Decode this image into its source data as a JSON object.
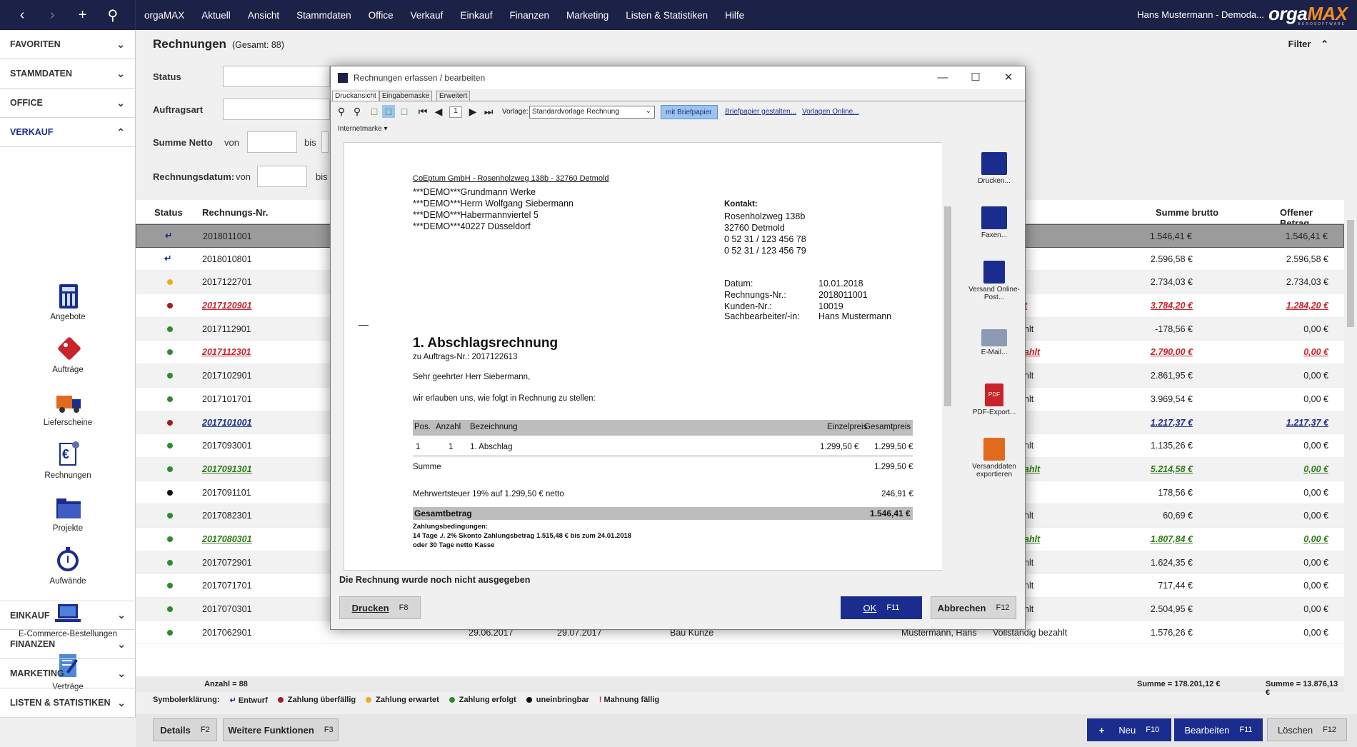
{
  "topbar": {
    "menu": [
      "orgaMAX",
      "Aktuell",
      "Ansicht",
      "Stammdaten",
      "Office",
      "Verkauf",
      "Einkauf",
      "Finanzen",
      "Marketing",
      "Listen & Statistiken",
      "Hilfe"
    ],
    "user": "Hans Mustermann - Demoda...",
    "logo_a": "orga",
    "logo_b": "MAX",
    "logo_sub": "BÜROSOFTWARE"
  },
  "sidebar": {
    "top": [
      "FAVORITEN",
      "STAMMDATEN",
      "OFFICE",
      "VERKAUF"
    ],
    "items": [
      "Angebote",
      "Aufträge",
      "Lieferscheine",
      "Rechnungen",
      "Projekte",
      "Aufwände",
      "E-Commerce-Bestellungen",
      "Verträge"
    ],
    "bottom": [
      "EINKAUF",
      "FINANZEN",
      "MARKETING",
      "LISTEN & STATISTIKEN"
    ]
  },
  "page": {
    "title": "Rechnungen",
    "count": "(Gesamt: 88)",
    "filter": "Filter",
    "status_lbl": "Status",
    "auftragsart_lbl": "Auftragsart",
    "summe_lbl": "Summe Netto",
    "von": "von",
    "bis": "bis",
    "datum_lbl": "Rechnungsdatum:",
    "datum_von": "von"
  },
  "grid": {
    "headers": {
      "status": "Status",
      "nr": "Rechnungs-Nr.",
      "brutto": "Summe brutto",
      "offen": "Offener Betrag"
    },
    "rows": [
      {
        "nr": "2018011001",
        "brutto": "1.546,41 €",
        "offen": "1.546,41 €",
        "mid": ""
      },
      {
        "nr": "2018010801",
        "brutto": "2.596,58 €",
        "offen": "2.596,58 €",
        "mid": ""
      },
      {
        "nr": "2017122701",
        "brutto": "2.734,03 €",
        "offen": "2.734,03 €",
        "mid": ""
      },
      {
        "nr": "2017120901",
        "brutto": "3.784,20 €",
        "offen": "1.284,20 €",
        "mid": "t"
      },
      {
        "nr": "2017112901",
        "brutto": "-178,56 €",
        "offen": "0,00 €",
        "mid": "hlt"
      },
      {
        "nr": "2017112301",
        "brutto": "2.790,00 €",
        "offen": "0,00 €",
        "mid": "ahlt"
      },
      {
        "nr": "2017102901",
        "brutto": "2.861,95 €",
        "offen": "0,00 €",
        "mid": "hlt"
      },
      {
        "nr": "2017101701",
        "brutto": "3.969,54 €",
        "offen": "0,00 €",
        "mid": "hlt"
      },
      {
        "nr": "2017101001",
        "brutto": "1.217,37 €",
        "offen": "1.217,37 €",
        "mid": ""
      },
      {
        "nr": "2017093001",
        "brutto": "1.135,26 €",
        "offen": "0,00 €",
        "mid": "hlt"
      },
      {
        "nr": "2017091301",
        "brutto": "5.214,58 €",
        "offen": "0,00 €",
        "mid": "ahlt"
      },
      {
        "nr": "2017091101",
        "brutto": "178,56 €",
        "offen": "0,00 €",
        "mid": ""
      },
      {
        "nr": "2017082301",
        "brutto": "60,69 €",
        "offen": "0,00 €",
        "mid": "hlt"
      },
      {
        "nr": "2017080301",
        "brutto": "1.807,84 €",
        "offen": "0,00 €",
        "mid": "ahlt"
      },
      {
        "nr": "2017072901",
        "brutto": "1.624,35 €",
        "offen": "0,00 €",
        "mid": "hlt"
      },
      {
        "nr": "2017071701",
        "brutto": "717,44 €",
        "offen": "0,00 €",
        "mid": "hlt"
      },
      {
        "nr": "2017070301",
        "brutto": "2.504,95 €",
        "offen": "0,00 €",
        "mid": "hlt"
      },
      {
        "nr": "2017062901",
        "brutto": "1.576,26 €",
        "offen": "0,00 €",
        "mid": "Vollständig bezahlt",
        "d1": "29.06.2017",
        "d2": "29.07.2017",
        "proj": "Bau Kunze",
        "bearb": "Mustermann, Hans"
      }
    ],
    "footer": {
      "anzahl": "Anzahl = 88",
      "summe1": "Summe = 178.201,12 €",
      "summe2": "Summe = 13.876,13 €"
    }
  },
  "legend": {
    "title": "Symbolerklärung:",
    "items": [
      "Entwurf",
      "Zahlung überfällig",
      "Zahlung erwartet",
      "Zahlung erfolgt",
      "uneinbringbar",
      "Mahnung fällig"
    ]
  },
  "buttons": {
    "details": "Details",
    "details_key": "F2",
    "weitere": "Weitere Funktionen",
    "weitere_key": "F3",
    "neu": "Neu",
    "neu_key": "F10",
    "bearbeiten": "Bearbeiten",
    "bearbeiten_key": "F11",
    "loeschen": "Löschen",
    "loeschen_key": "F12"
  },
  "dialog": {
    "title": "Rechnungen erfassen / bearbeiten",
    "tabs": [
      "Druckansicht",
      "Eingabemaske",
      "Erweitert"
    ],
    "page_num": "1",
    "vorlage_lbl": "Vorlage:",
    "vorlage": "Standardvorlage Rechnung",
    "briefpapier_btn": "mit Briefpapier",
    "link1": "Briefpapier gestalten...",
    "link2": "Vorlagen Online...",
    "internetmarke": "Internetmarke",
    "side": [
      "Drucken...",
      "Faxen...",
      "Versand Online-Post...",
      "E-Mail...",
      "PDF-Export...",
      "Versanddaten exportieren"
    ],
    "status": "Die Rechnung wurde noch nicht ausgegeben",
    "print": "Drucken",
    "print_key": "F8",
    "ok": "OK",
    "ok_key": "F11",
    "cancel": "Abbrechen",
    "cancel_key": "F12"
  },
  "doc": {
    "sender": "CoEptum GmbH - Rosenholzweg 138b - 32760 Detmold",
    "addr": [
      "***DEMO***Grundmann Werke",
      "***DEMO***Herrn Wolfgang Siebermann",
      "***DEMO***Habermannviertel 5",
      "***DEMO***40227 Düsseldorf"
    ],
    "kontakt_lbl": "Kontakt:",
    "kontakt": [
      "Rosenholzweg 138b",
      "32760 Detmold",
      "0 52 31 / 123 456 78",
      "0 52 31 / 123 456 79"
    ],
    "meta_lbl": [
      "Datum:",
      "Rechnungs-Nr.:",
      "Kunden-Nr.:",
      "Sachbearbeiter/-in:"
    ],
    "meta_val": [
      "10.01.2018",
      "2018011001",
      "10019",
      "Hans Mustermann"
    ],
    "title": "1. Abschlagsrechnung",
    "auftrag": "zu Auftrags-Nr.: 2017122613",
    "greeting": "Sehr geehrter Herr Siebermann,",
    "intro": "wir erlauben uns, wie folgt in Rechnung zu stellen:",
    "th": [
      "Pos.",
      "Anzahl",
      "Bezeichnung",
      "Einzelpreis",
      "Gesamtpreis"
    ],
    "row": [
      "1",
      "1",
      "1. Abschlag",
      "1.299,50 €",
      "1.299,50 €"
    ],
    "summe_lbl": "Summe",
    "summe": "1.299,50 €",
    "mwst_lbl": "Mehrwertsteuer 19% auf 1.299,50 € netto",
    "mwst": "246,91 €",
    "gesamt_lbl": "Gesamtbetrag",
    "gesamt": "1.546,41 €",
    "zb": [
      "Zahlungsbedingungen:",
      "14 Tage ./. 2% Skonto Zahlungsbetrag 1.515,48 € bis zum 24.01.2018",
      "oder 30 Tage netto Kasse"
    ]
  },
  "colors": {
    "navy": "#1c2147",
    "accent": "#1a2d8f",
    "overdue": "#a31d1d",
    "expected": "#f5a623",
    "paid": "#2e8b2e",
    "bad": "#111111",
    "draft": "#1a2d8f"
  }
}
